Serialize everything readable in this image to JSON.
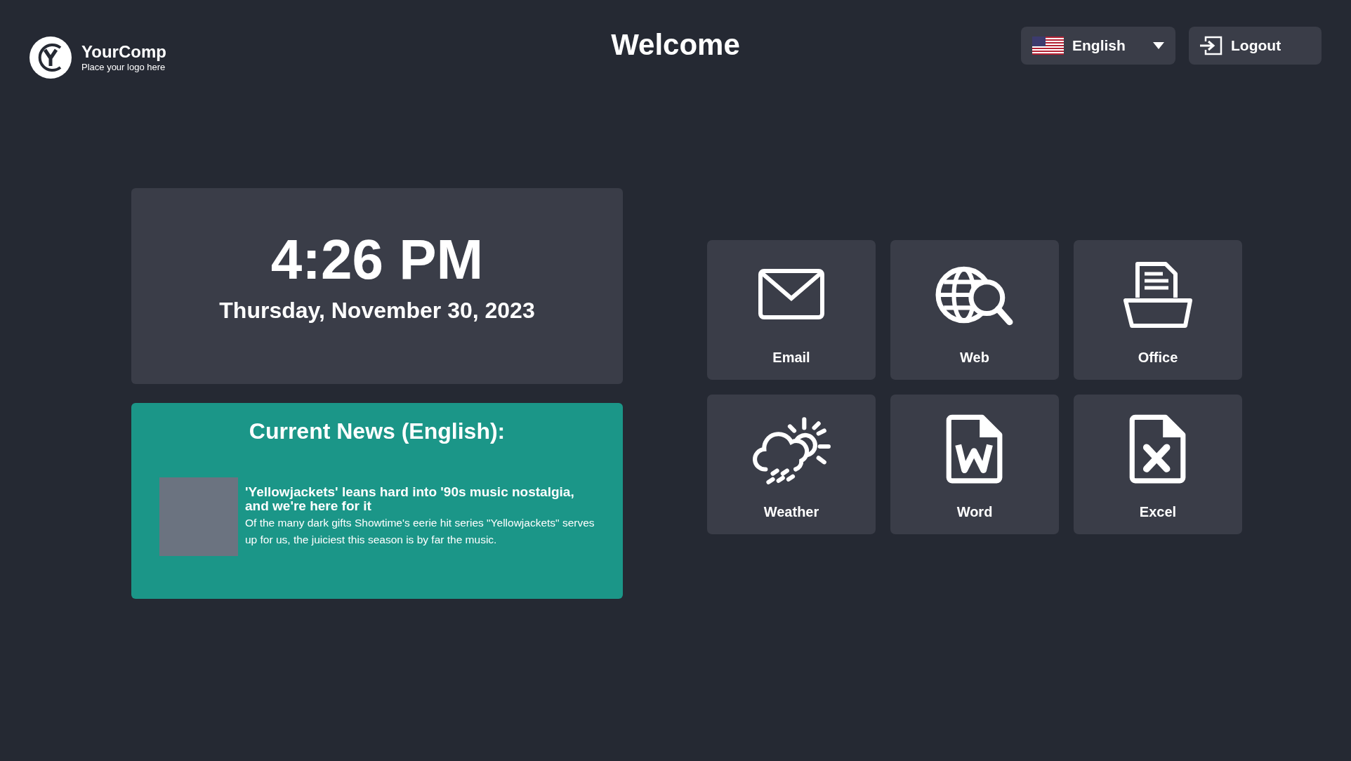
{
  "logo": {
    "name": "YourComp",
    "tagline": "Place your logo here"
  },
  "title": "Welcome",
  "language": {
    "label": "English"
  },
  "logout": {
    "label": "Logout"
  },
  "clock": {
    "time": "4:26 PM",
    "date": "Thursday, November 30, 2023"
  },
  "news": {
    "heading": "Current News (English):",
    "items": [
      {
        "headline": "'Yellowjackets' leans hard into '90s music nostalgia, and we're here for it",
        "summary": "Of the many dark gifts Showtime's eerie hit series \"Yellowjackets\" serves up for us, the juiciest this season is by far the music."
      }
    ]
  },
  "tiles": [
    {
      "kind": "email",
      "label": "Email"
    },
    {
      "kind": "web",
      "label": "Web"
    },
    {
      "kind": "office",
      "label": "Office"
    },
    {
      "kind": "weather",
      "label": "Weather"
    },
    {
      "kind": "word",
      "label": "Word"
    },
    {
      "kind": "excel",
      "label": "Excel"
    }
  ]
}
